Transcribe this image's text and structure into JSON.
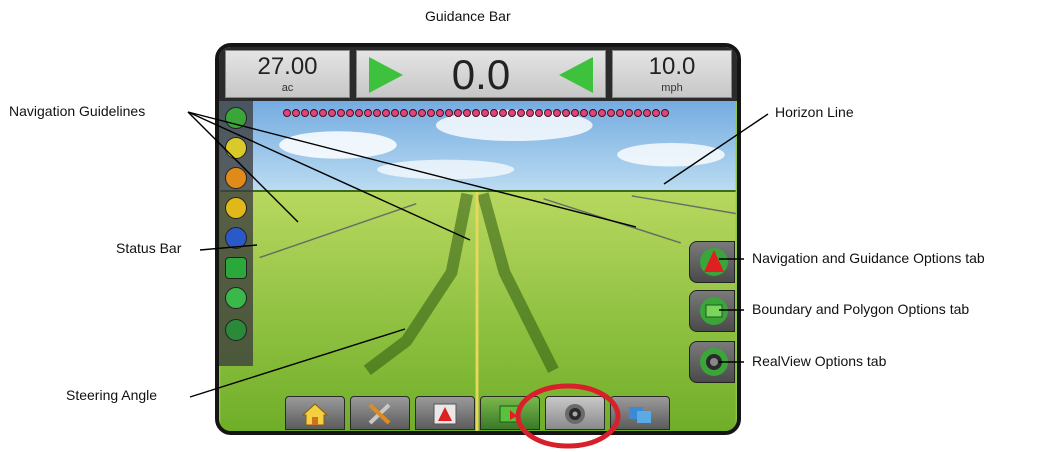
{
  "callouts": {
    "guidance_bar": "Guidance Bar",
    "navigation_guidelines": "Navigation Guidelines",
    "horizon_line": "Horizon Line",
    "status_bar": "Status Bar",
    "navigation_guidance_tab": "Navigation and Guidance Options tab",
    "boundary_polygon_tab": "Boundary and Polygon Options tab",
    "realview_tab": "RealView Options tab",
    "steering_angle": "Steering Angle"
  },
  "screen": {
    "area": {
      "value": "27.00",
      "unit": "ac"
    },
    "cross_track": "0.0",
    "speed": {
      "value": "10.0",
      "unit": "mph"
    }
  },
  "icons": {
    "bottom": [
      "home-icon",
      "tools-icon",
      "navigation-icon",
      "boundary-icon",
      "realview-icon",
      "data-icon"
    ],
    "right_tabs": [
      "navigation-guidance-icon",
      "boundary-polygon-icon",
      "realview-camera-icon"
    ]
  },
  "colors": {
    "led": "#e0457a",
    "arrow": "#3ec23e",
    "highlight": "#d8202a"
  }
}
